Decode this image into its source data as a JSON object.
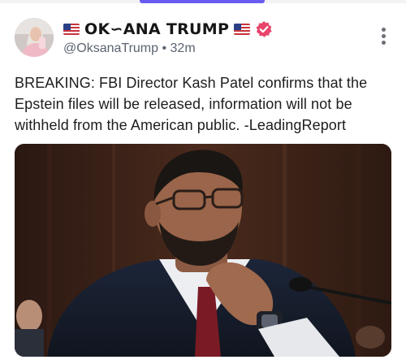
{
  "post": {
    "author": {
      "display_name": "OK∽ANA TRUMP",
      "handle": "@OksanaTrump",
      "separator": "•",
      "time_ago": "32m",
      "verified": true
    },
    "text": "BREAKING: FBI Director Kash Patel confirms that the Epstein files will be released, information will not be withheld from the American public. -LeadingReport"
  },
  "colors": {
    "accent": "#6a5cf0",
    "verified_badge": "#e8456b",
    "text_secondary": "#5c6370"
  },
  "icons": {
    "flags": "us-flag-icon",
    "verified": "verified-badge-icon",
    "menu": "more-vertical-icon"
  }
}
